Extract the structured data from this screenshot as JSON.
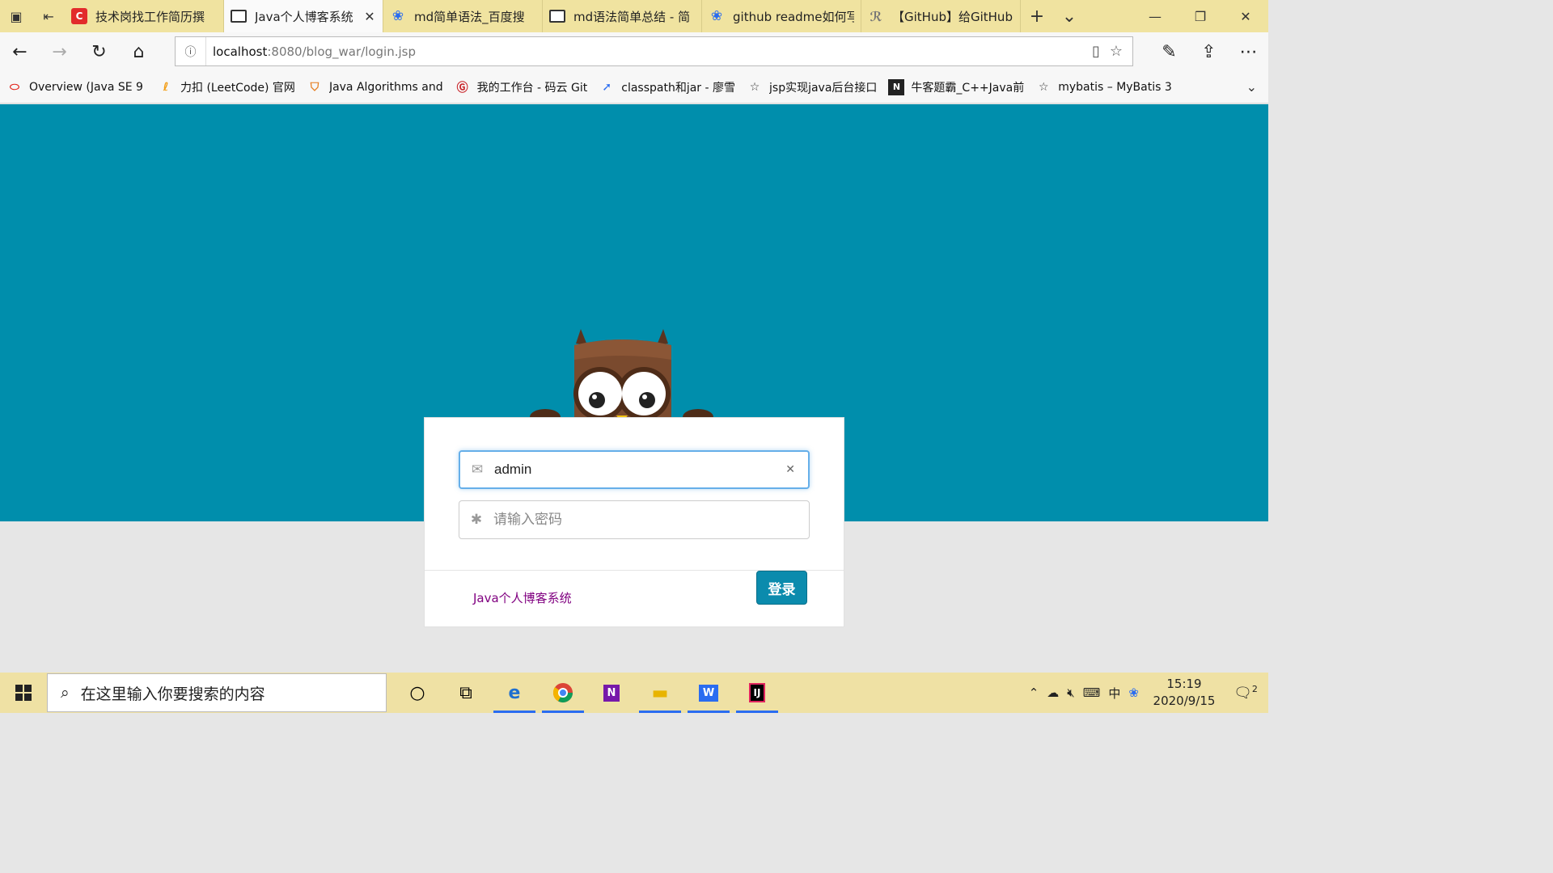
{
  "browser": {
    "tabs": [
      {
        "label": "技术岗找工作简历撰",
        "icon": "csdn-icon"
      },
      {
        "label": "Java个人博客系统",
        "icon": "page-icon",
        "active": true
      },
      {
        "label": "md简单语法_百度搜",
        "icon": "baidu-paw-icon"
      },
      {
        "label": "md语法简单总结 - 简",
        "icon": "page-icon"
      },
      {
        "label": "github readme如何写",
        "icon": "baidu-paw-icon"
      },
      {
        "label": "【GitHub】给GitHub",
        "icon": "site-icon"
      }
    ],
    "address": {
      "host": "localhost",
      "rest": ":8080/blog_war/login.jsp"
    },
    "favorites": [
      {
        "label": "Overview (Java SE 9 &",
        "icon": "oracle-icon"
      },
      {
        "label": "力扣 (LeetCode) 官网",
        "icon": "leetcode-icon"
      },
      {
        "label": "Java Algorithms and",
        "icon": "princeton-icon"
      },
      {
        "label": "我的工作台 - 码云 Git",
        "icon": "gitee-icon"
      },
      {
        "label": "classpath和jar - 廖雪",
        "icon": "rocket-icon"
      },
      {
        "label": "jsp实现java后台接口",
        "icon": "star-icon"
      },
      {
        "label": "牛客题霸_C++Java前",
        "icon": "nowcoder-icon"
      },
      {
        "label": "mybatis – MyBatis 3 |",
        "icon": "star-icon"
      }
    ]
  },
  "login": {
    "username_value": "admin",
    "password_placeholder": "请输入密码",
    "system_link": "Java个人博客系统",
    "login_button": "登录"
  },
  "colors": {
    "accent": "#008eac",
    "button": "#0b8bad",
    "link": "#800080"
  },
  "taskbar": {
    "search_placeholder": "在这里输入你要搜索的内容",
    "time": "15:19",
    "date": "2020/9/15",
    "notification_count": "2",
    "ime": "中"
  }
}
